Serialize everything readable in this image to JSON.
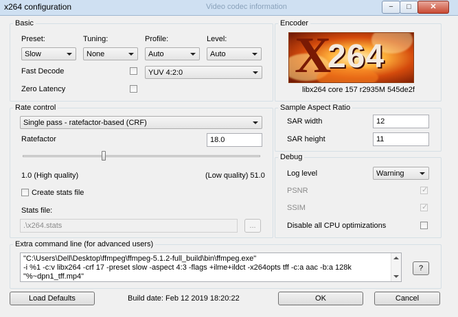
{
  "window": {
    "title": "x264 configuration",
    "background_title": "Video codec information",
    "controls": {
      "minimize": "−",
      "maximize": "□",
      "close": "✕"
    }
  },
  "basic": {
    "legend": "Basic",
    "preset_label": "Preset:",
    "preset_value": "Slow",
    "tuning_label": "Tuning:",
    "tuning_value": "None",
    "profile_label": "Profile:",
    "profile_value": "Auto",
    "level_label": "Level:",
    "level_value": "Auto",
    "fast_decode_label": "Fast Decode",
    "fast_decode_checked": false,
    "zero_latency_label": "Zero Latency",
    "zero_latency_checked": false,
    "colorspace_value": "YUV 4:2:0"
  },
  "encoder": {
    "legend": "Encoder",
    "logo_text": "264",
    "version": "libx264 core 157 r2935M 545de2f"
  },
  "rate_control": {
    "legend": "Rate control",
    "mode_value": "Single pass - ratefactor-based (CRF)",
    "ratefactor_label": "Ratefactor",
    "ratefactor_value": "18.0",
    "slider_fraction": 0.34,
    "min_label": "1.0 (High quality)",
    "max_label": "(Low quality) 51.0",
    "create_stats_label": "Create stats file",
    "create_stats_checked": false,
    "stats_file_label": "Stats file:",
    "stats_file_value": ".\\x264.stats",
    "browse_label": "..."
  },
  "sar": {
    "legend": "Sample Aspect Ratio",
    "width_label": "SAR width",
    "width_value": "12",
    "height_label": "SAR height",
    "height_value": "11"
  },
  "debug": {
    "legend": "Debug",
    "log_level_label": "Log level",
    "log_level_value": "Warning",
    "psnr_label": "PSNR",
    "psnr_checked": true,
    "ssim_label": "SSIM",
    "ssim_checked": true,
    "disable_cpu_label": "Disable all CPU optimizations",
    "disable_cpu_checked": false
  },
  "extra": {
    "legend": "Extra command line (for advanced users)",
    "lines": [
      "\"C:\\Users\\Dell\\Desktop\\ffmpeg\\ffmpeg-5.1.2-full_build\\bin\\ffmpeg.exe\"",
      " -i %1 -c:v libx264 -crf 17 -preset slow -aspect 4:3 -flags +ilme+ildct -x264opts tff -c:a aac -b:a 128k",
      " \"%~dpn1_tff.mp4\""
    ],
    "help_label": "?"
  },
  "footer": {
    "load_defaults_label": "Load Defaults",
    "build_date": "Build date: Feb 12 2019 18:20:22",
    "ok_label": "OK",
    "cancel_label": "Cancel"
  },
  "colors": {
    "titlebar": "#cfe0f2",
    "dialog_bg": "#f0f0f0",
    "group_border": "#d5dfe5"
  }
}
